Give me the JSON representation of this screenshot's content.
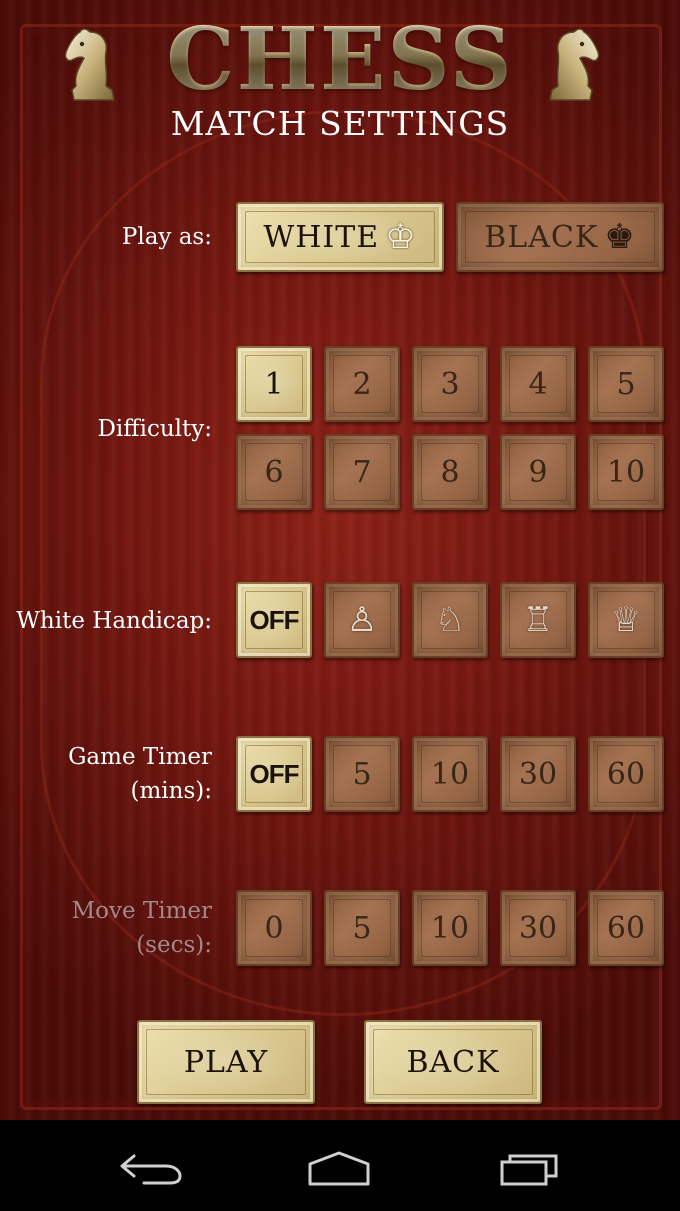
{
  "header": {
    "title": "CHESS",
    "subtitle": "MATCH SETTINGS"
  },
  "play_as": {
    "label": "Play as:",
    "options": [
      {
        "label": "WHITE",
        "icon": "white-king-icon",
        "glyph": "♔",
        "selected": true
      },
      {
        "label": "BLACK",
        "icon": "black-king-icon",
        "glyph": "♚",
        "selected": false
      }
    ]
  },
  "difficulty": {
    "label": "Difficulty:",
    "options": [
      "1",
      "2",
      "3",
      "4",
      "5",
      "6",
      "7",
      "8",
      "9",
      "10"
    ],
    "selected": "1"
  },
  "white_handicap": {
    "label": "White Handicap:",
    "off_label": "OFF",
    "options": [
      {
        "icon": "pawn-icon",
        "glyph": "♙"
      },
      {
        "icon": "knight-icon",
        "glyph": "♘"
      },
      {
        "icon": "rook-icon",
        "glyph": "♖"
      },
      {
        "icon": "queen-icon",
        "glyph": "♕"
      }
    ],
    "selected": "OFF"
  },
  "game_timer": {
    "label_line1": "Game Timer",
    "label_line2": "(mins):",
    "options": [
      "OFF",
      "5",
      "10",
      "30",
      "60"
    ],
    "selected": "OFF"
  },
  "move_timer": {
    "label_line1": "Move Timer",
    "label_line2": "(secs):",
    "options": [
      "0",
      "5",
      "10",
      "30",
      "60"
    ],
    "disabled": true
  },
  "actions": {
    "play": "PLAY",
    "back": "BACK"
  },
  "navbar": {
    "icons": [
      "back-icon",
      "home-icon",
      "recent-apps-icon"
    ]
  },
  "colors": {
    "background": "#7a1810",
    "tile": "#a06d4c",
    "tile_selected": "#dccb93",
    "label": "#ffffff",
    "label_disabled": "#a4898a"
  }
}
